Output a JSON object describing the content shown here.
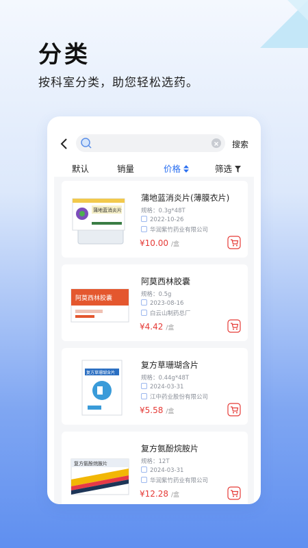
{
  "hero": {
    "title": "分类",
    "subtitle": "按科室分类，助您轻松选药。"
  },
  "search": {
    "value": "",
    "placeholder": "",
    "button_label": "搜索"
  },
  "sort_tabs": [
    {
      "label": "默认",
      "active": false
    },
    {
      "label": "销量",
      "active": false
    },
    {
      "label": "价格",
      "active": true,
      "icon": "sort-updown-icon"
    },
    {
      "label": "筛选",
      "active": false,
      "icon": "filter-icon"
    }
  ],
  "products": [
    {
      "name": "蒲地蓝消炎片(薄膜衣片)",
      "spec": "规格：0.3g*48T",
      "date": "2022-10-26",
      "maker": "华润紫竹药业有限公司",
      "price": "¥10.00",
      "unit": "/盒",
      "box_text": "蒲地蓝消炎片"
    },
    {
      "name": "阿莫西林胶囊",
      "spec": "规格：0.5g",
      "date": "2023-08-16",
      "maker": "白云山制药总厂",
      "price": "¥4.42",
      "unit": "/盒",
      "box_text": "阿莫西林胶囊"
    },
    {
      "name": "复方草珊瑚含片",
      "spec": "规格：0.44g*48T",
      "date": "2024-03-31",
      "maker": "江中药业股份有限公司",
      "price": "¥5.58",
      "unit": "/盒",
      "box_text": "复方草珊瑚含片"
    },
    {
      "name": "复方氨酚烷胺片",
      "spec": "规格：12T",
      "date": "2024-03-31",
      "maker": "华润紫竹药业有限公司",
      "price": "¥12.28",
      "unit": "/盒",
      "box_text": "复方氨酚烷胺片"
    }
  ],
  "colors": {
    "accent": "#2a6ff0",
    "price": "#e53935"
  }
}
